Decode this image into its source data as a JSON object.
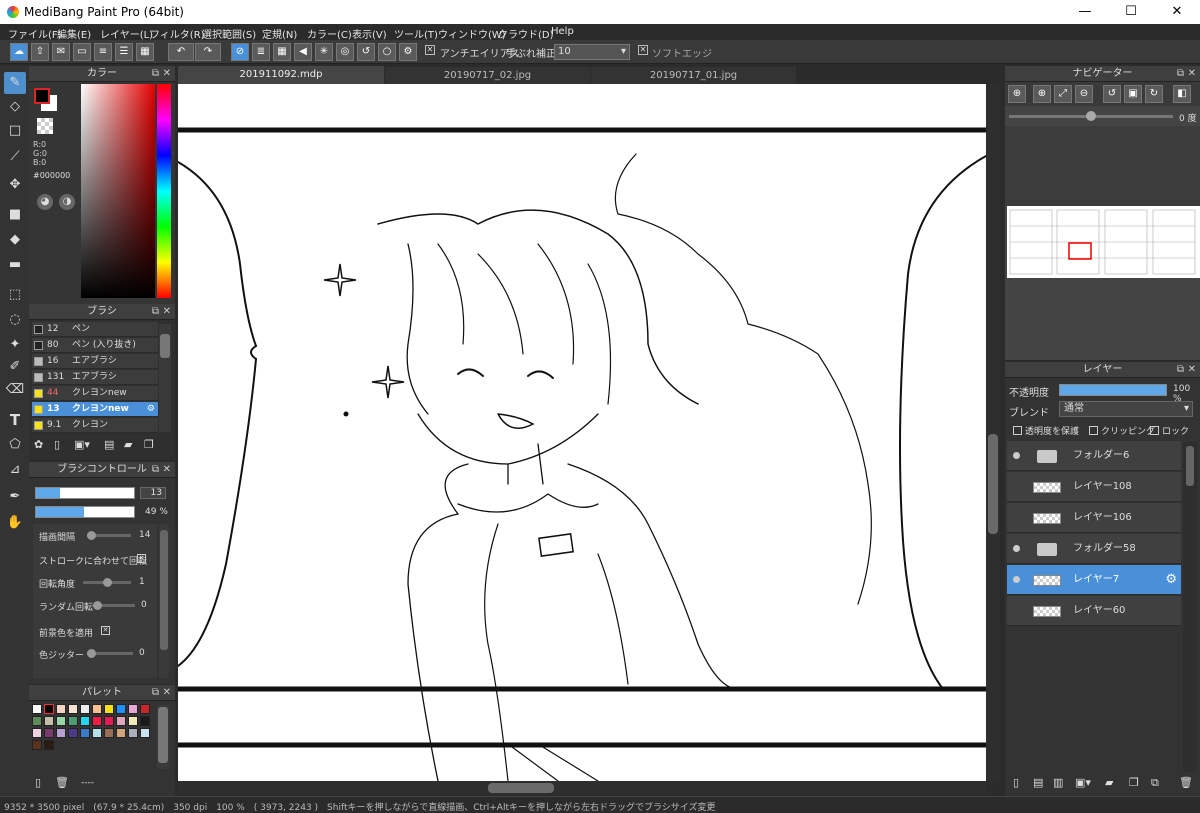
{
  "title": "MediBang Paint Pro (64bit)",
  "window_controls": {
    "minimize": "—",
    "maximize": "☐",
    "close": "✕"
  },
  "menu": [
    "ファイル(F)",
    "編集(E)",
    "レイヤー(L)",
    "フィルタ(R)",
    "選択範囲(S)",
    "定規(N)",
    "カラー(C)",
    "表示(V)",
    "ツール(T)",
    "ウィンドウ(W)",
    "クラウド(D)",
    "Help"
  ],
  "toolbar": {
    "antialias_label": "アンチエイリアス",
    "stabilizer_label": "手ぶれ補正",
    "stabilizer_value": "10",
    "soft_edge_label": "ソフトエッジ"
  },
  "tabs": [
    "201911092.mdp",
    "20190717_02.jpg",
    "20190717_01.jpg"
  ],
  "color_panel": {
    "title": "カラー",
    "r": "R:0",
    "g": "G:0",
    "b": "B:0",
    "hex": "#000000",
    "fg": "#000000",
    "bg": "#ffffff"
  },
  "brush_panel": {
    "title": "ブラシ",
    "items": [
      {
        "size": "12",
        "name": "ペン",
        "color": "#222222"
      },
      {
        "size": "80",
        "name": "ペン (入り抜き)",
        "color": "#222222"
      },
      {
        "size": "16",
        "name": "エアブラシ",
        "color": "#bbbbbb"
      },
      {
        "size": "131",
        "name": "エアブラシ",
        "color": "#bbbbbb"
      },
      {
        "size": "44",
        "name": "クレヨンnew",
        "color": "#f4e11a"
      },
      {
        "size": "13",
        "name": "クレヨンnew",
        "color": "#f4e11a"
      },
      {
        "size": "9.1",
        "name": "クレヨン",
        "color": "#f4e11a"
      }
    ]
  },
  "brush_control": {
    "title": "ブラシコントロール",
    "size_value": "13",
    "opacity_value": "49 %",
    "spacing_label": "描画間隔",
    "spacing_value": "14",
    "rotate_stroke_label": "ストロークに合わせて回転",
    "rotation_label": "回転角度",
    "rotation_value": "1",
    "random_rot_label": "ランダム回転",
    "random_rot_value": "0",
    "fg_color_label": "前景色を適用",
    "jitter_label": "色ジッター",
    "jitter_value": "0"
  },
  "palette": {
    "title": "パレット",
    "footer": "----",
    "colors": [
      "#ffffff",
      "#000000",
      "#f4d3c2",
      "#f7e1d1",
      "#eeeeee",
      "#f9c08f",
      "#f4e11a",
      "#1e90ff",
      "#e8a8d6",
      "#c8262c",
      "#5f8c5a",
      "#c7c0a8",
      "#98d5a4",
      "#4d9a74",
      "#23d8ea",
      "#f41c43",
      "#e51a55",
      "#e0a6bf",
      "#f0eab8",
      "#1a1a1a",
      "#f0d1e0",
      "#7b3a6e",
      "#b6a0d2",
      "#4b3a8a",
      "#3a7ac8",
      "#b5dfe9",
      "#9a6d56",
      "#d2a57c",
      "#aab0bb",
      "#cbe2f0",
      "#5a3320",
      "#2a1c12"
    ]
  },
  "navigator": {
    "title": "ナビゲーター",
    "angle": "0 度"
  },
  "layers": {
    "title": "レイヤー",
    "opacity_label": "不透明度",
    "opacity_value": "100 %",
    "blend_label": "ブレンド",
    "blend_value": "通常",
    "protect_label": "透明度を保護",
    "clip_label": "クリッピング",
    "lock_label": "ロック",
    "items": [
      {
        "name": "フォルダー6",
        "type": "folder",
        "visible": true
      },
      {
        "name": "レイヤー108",
        "type": "layer",
        "visible": false
      },
      {
        "name": "レイヤー106",
        "type": "layer",
        "visible": false
      },
      {
        "name": "フォルダー58",
        "type": "folder",
        "visible": true
      },
      {
        "name": "レイヤー7",
        "type": "layer",
        "visible": true,
        "selected": true
      },
      {
        "name": "レイヤー60",
        "type": "layer",
        "visible": false
      }
    ]
  },
  "status": "9352 * 3500 pixel　(67.9 * 25.4cm)　350 dpi　100 %　( 3973, 2243 )　Shiftキーを押しながらで直線描画、Ctrl+Altキーを押しながら左右ドラッグでブラシサイズ変更"
}
